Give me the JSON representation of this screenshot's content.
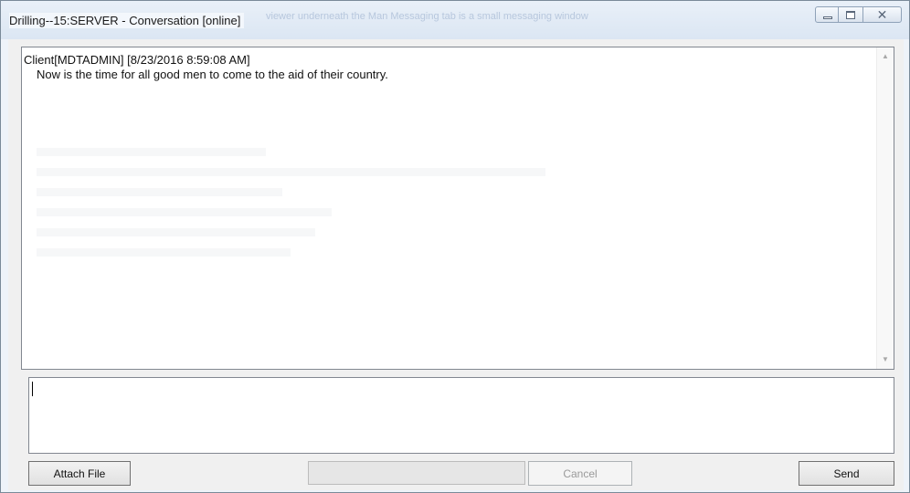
{
  "window": {
    "title": "Drilling--15:SERVER - Conversation [online]",
    "background_text": "viewer underneath the Man Messaging tab is a small messaging window"
  },
  "history": {
    "messages": [
      {
        "header": "Client[MDTADMIN]  [8/23/2016 8:59:08 AM]",
        "body": "Now is the time for all good men to come to the aid of their country."
      }
    ]
  },
  "compose": {
    "value": ""
  },
  "buttons": {
    "attach": "Attach File",
    "cancel": "Cancel",
    "send": "Send"
  },
  "progress": {
    "fraction": 0
  },
  "icons": {
    "minimize": "minimize-icon",
    "maximize": "maximize-icon",
    "close": "close-icon",
    "scroll_up": "scroll-up-arrow-icon",
    "scroll_down": "scroll-down-arrow-icon"
  },
  "colors": {
    "titlebar": "#dbe6f3",
    "window_bg": "#f0f0f0"
  }
}
